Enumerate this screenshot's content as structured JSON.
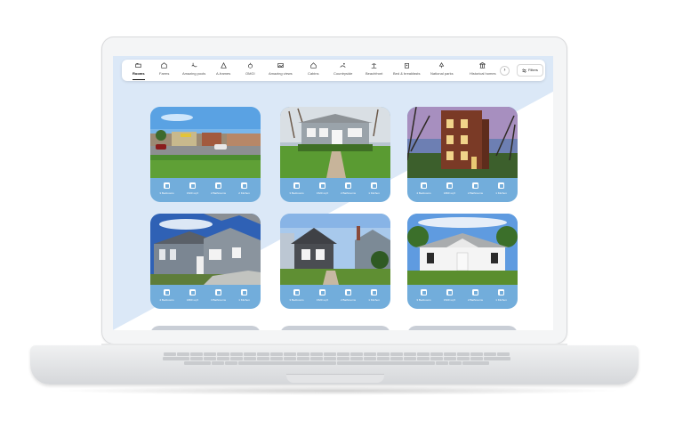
{
  "categories": [
    {
      "label": "Rooms",
      "icon": "rooms-icon",
      "active": true
    },
    {
      "label": "Farms",
      "icon": "farm-icon"
    },
    {
      "label": "Amazing pools",
      "icon": "pool-icon"
    },
    {
      "label": "A-frames",
      "icon": "a-frame-icon"
    },
    {
      "label": "OMG!",
      "icon": "omg-icon"
    },
    {
      "label": "Amazing views",
      "icon": "views-icon"
    },
    {
      "label": "Cabins",
      "icon": "cabin-icon"
    },
    {
      "label": "Countryside",
      "icon": "countryside-icon"
    },
    {
      "label": "Beachfront",
      "icon": "beach-icon"
    },
    {
      "label": "Bed & breakfasts",
      "icon": "bnb-icon"
    },
    {
      "label": "National parks",
      "icon": "park-icon"
    },
    {
      "label": "Historical homes",
      "icon": "historic-icon"
    }
  ],
  "filters_label": "Filters",
  "next_arrow": "›",
  "listings": [
    {
      "photo": "commercial-strip",
      "stats": [
        "3 Bedrooms",
        "1520 sq ft",
        "2 Bathrooms",
        "2 Kitchen"
      ]
    },
    {
      "photo": "gray-bungalow",
      "stats": [
        "3 Bedrooms",
        "1520 sq ft",
        "2 Bathrooms",
        "1 Kitchen"
      ]
    },
    {
      "photo": "brick-apartment",
      "stats": [
        "4 Bedrooms",
        "1800 sq ft",
        "2 Bathrooms",
        "1 Kitchen"
      ]
    },
    {
      "photo": "gray-two-story",
      "stats": [
        "4 Bedrooms",
        "1800 sq ft",
        "3 Bathrooms",
        "1 Kitchen"
      ]
    },
    {
      "photo": "dark-cottage",
      "stats": [
        "3 Bedrooms",
        "1520 sq ft",
        "2 Bathrooms",
        "1 Kitchen"
      ]
    },
    {
      "photo": "white-ranch",
      "stats": [
        "3 Bedrooms",
        "1520 sq ft",
        "2 Bathrooms",
        "1 Kitchen"
      ]
    }
  ],
  "colors": {
    "card_accent": "#72addb",
    "screen_accent": "#dbe8f7"
  }
}
